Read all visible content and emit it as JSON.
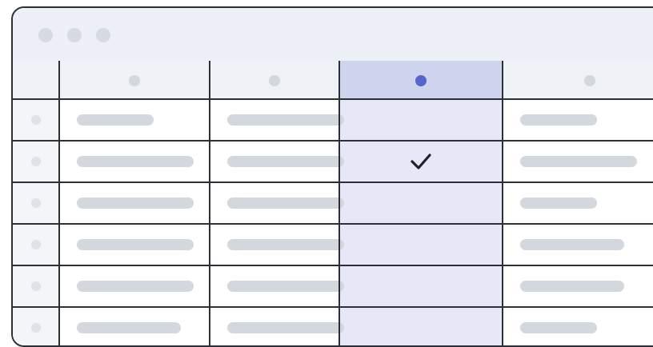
{
  "window": {
    "traffic_lights": [
      "window-dot-1",
      "window-dot-2",
      "window-dot-3"
    ]
  },
  "table": {
    "columns": [
      {
        "name": "column-1",
        "selected": false
      },
      {
        "name": "column-2",
        "selected": false
      },
      {
        "name": "column-3",
        "selected": true
      },
      {
        "name": "column-4",
        "selected": false
      }
    ],
    "rows": [
      {
        "bars": [
          "short",
          "long",
          null,
          "short"
        ],
        "checked": false
      },
      {
        "bars": [
          "long",
          "long",
          null,
          "long"
        ],
        "checked": true
      },
      {
        "bars": [
          "long",
          "long",
          null,
          "short"
        ],
        "checked": false
      },
      {
        "bars": [
          "long",
          "long",
          null,
          "medium"
        ],
        "checked": false
      },
      {
        "bars": [
          "long",
          "long",
          null,
          "medium"
        ],
        "checked": false
      },
      {
        "bars": [
          "medium",
          "long",
          null,
          "short"
        ],
        "checked": false
      }
    ],
    "check_icon": "checkmark-icon"
  },
  "colors": {
    "accent": "#5566cc",
    "selected_column": "#e6e8f8",
    "selected_header": "#cfd4ee",
    "grid_line": "#2b2f36",
    "placeholder_bar": "#d3d7de"
  }
}
